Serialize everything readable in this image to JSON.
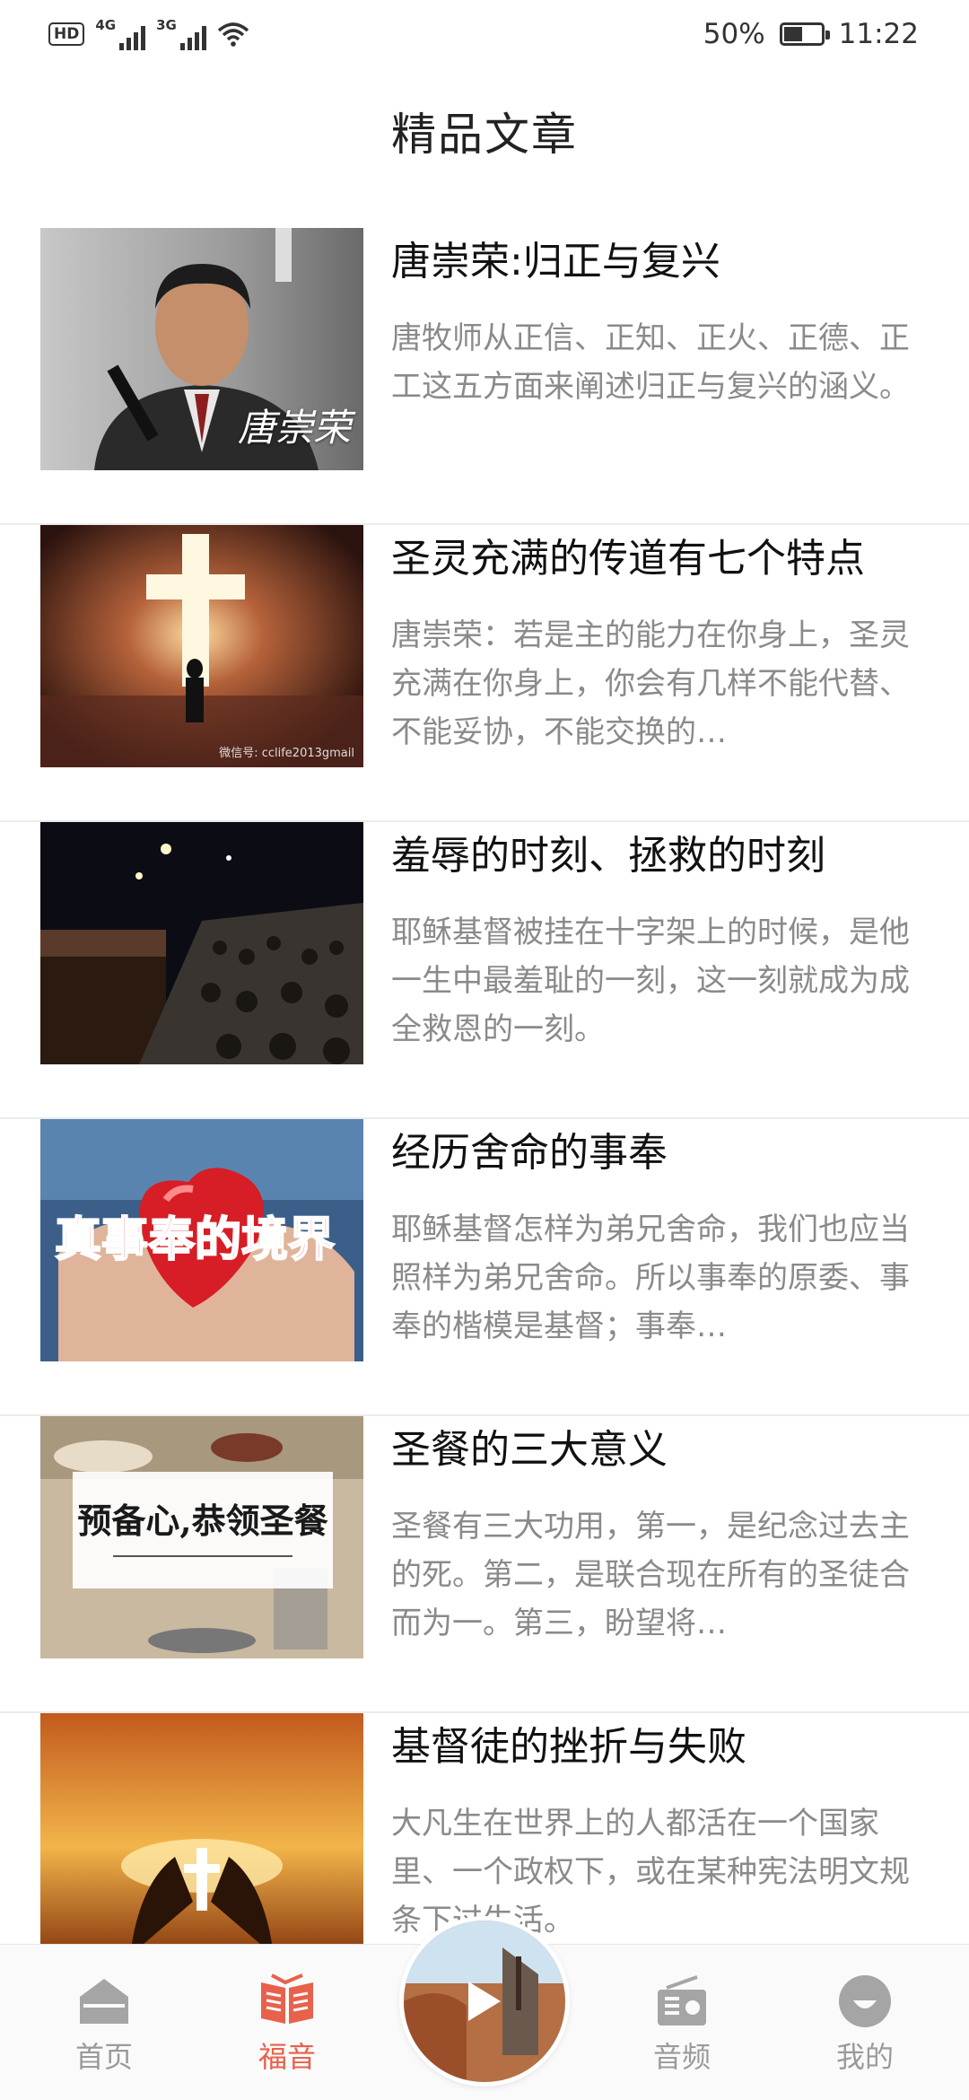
{
  "status_bar": {
    "hd": "HD",
    "sim1_network": "4G",
    "sim2_network": "3G",
    "battery_text": "50%",
    "battery_level": 0.5,
    "time": "11:22",
    "icons": [
      "hd-icon",
      "signal-icon",
      "signal-icon",
      "wifi-icon",
      "battery-icon"
    ]
  },
  "page": {
    "title": "精品文章"
  },
  "articles": [
    {
      "title": "唐崇荣:归正与复兴",
      "summary": "唐牧师从正信、正知、正火、正德、正工这五方面来阐述归正与复兴的涵义。",
      "thumb_caption": "唐崇荣"
    },
    {
      "title": "圣灵充满的传道有七个特点",
      "summary": "唐崇荣：若是主的能力在你身上，圣灵充满在你身上，你会有几样不能代替、不能妥协，不能交换的…",
      "thumb_caption": "微信号: cclife2013gmail"
    },
    {
      "title": "羞辱的时刻、拯救的时刻",
      "summary": "耶稣基督被挂在十字架上的时候，是他一生中最羞耻的一刻，这一刻就成为成全救恩的一刻。",
      "thumb_caption": ""
    },
    {
      "title": "经历舍命的事奉",
      "summary": "耶稣基督怎样为弟兄舍命，我们也应当照样为弟兄舍命。所以事奉的原委、事奉的楷模是基督；事奉…",
      "thumb_caption": "真事奉的境界"
    },
    {
      "title": "圣餐的三大意义",
      "summary": "圣餐有三大功用，第一，是纪念过去主的死。第二，是联合现在所有的圣徒合而为一。第三，盼望将…",
      "thumb_caption": "预备心,恭领圣餐"
    },
    {
      "title": "基督徒的挫折与失败",
      "summary": "大凡生在世界上的人都活在一个国家里、一个政权下，或在某种宪法明文规条下过生活。",
      "thumb_caption": ""
    }
  ],
  "bottom_nav": {
    "items": [
      {
        "label": "首页",
        "icon": "home-icon",
        "active": false
      },
      {
        "label": "福音",
        "icon": "book-icon",
        "active": true
      },
      {
        "label": "音频",
        "icon": "radio-icon",
        "active": false
      },
      {
        "label": "我的",
        "icon": "profile-icon",
        "active": false
      }
    ],
    "player": {
      "icon": "play-icon"
    }
  },
  "colors": {
    "accent": "#e8614b",
    "inactive": "#9a9a9a",
    "summary_text": "#8a8a8a"
  }
}
